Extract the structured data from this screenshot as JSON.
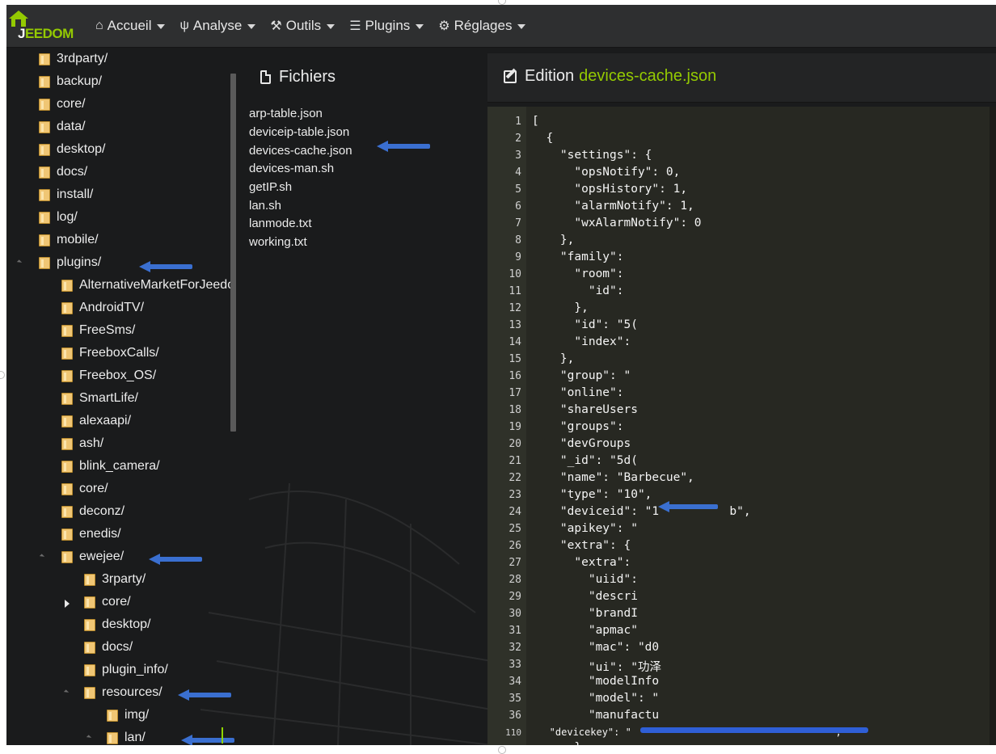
{
  "navbar": {
    "logo_text": "EEDOM",
    "logo_small_text": "Jeedom",
    "menus": [
      {
        "label": "Accueil",
        "icon": "home-icon"
      },
      {
        "label": "Analyse",
        "icon": "stethoscope-icon"
      },
      {
        "label": "Outils",
        "icon": "wrench-icon"
      },
      {
        "label": "Plugins",
        "icon": "tasks-icon"
      },
      {
        "label": "Réglages",
        "icon": "gear-icon"
      }
    ]
  },
  "tree": {
    "items": [
      {
        "label": "3rdparty/"
      },
      {
        "label": "backup/"
      },
      {
        "label": "core/"
      },
      {
        "label": "data/"
      },
      {
        "label": "desktop/"
      },
      {
        "label": "docs/"
      },
      {
        "label": "install/"
      },
      {
        "label": "log/"
      },
      {
        "label": "mobile/"
      },
      {
        "label": "plugins/"
      },
      {
        "label": "AlternativeMarketForJeedom/"
      },
      {
        "label": "AndroidTV/"
      },
      {
        "label": "FreeSms/"
      },
      {
        "label": "FreeboxCalls/"
      },
      {
        "label": "Freebox_OS/"
      },
      {
        "label": "SmartLife/"
      },
      {
        "label": "alexaapi/"
      },
      {
        "label": "ash/"
      },
      {
        "label": "blink_camera/"
      },
      {
        "label": "core/"
      },
      {
        "label": "deconz/"
      },
      {
        "label": "enedis/"
      },
      {
        "label": "ewejee/"
      },
      {
        "label": "3rparty/"
      },
      {
        "label": "core/"
      },
      {
        "label": "desktop/"
      },
      {
        "label": "docs/"
      },
      {
        "label": "plugin_info/"
      },
      {
        "label": "resources/"
      },
      {
        "label": "img/"
      },
      {
        "label": "lan/"
      }
    ]
  },
  "files": {
    "title": "Fichiers",
    "items": [
      "arp-table.json",
      "deviceip-table.json",
      "devices-cache.json",
      "devices-man.sh",
      "getIP.sh",
      "lan.sh",
      "lanmode.txt",
      "working.txt"
    ]
  },
  "editor": {
    "title_prefix": "Edition",
    "filename": "devices-cache.json",
    "lines": [
      {
        "n": "1",
        "t": "["
      },
      {
        "n": "2",
        "t": "  {"
      },
      {
        "n": "3",
        "t": "    \"settings\": {"
      },
      {
        "n": "4",
        "t": "      \"opsNotify\": 0,"
      },
      {
        "n": "5",
        "t": "      \"opsHistory\": 1,"
      },
      {
        "n": "6",
        "t": "      \"alarmNotify\": 1,"
      },
      {
        "n": "7",
        "t": "      \"wxAlarmNotify\": 0"
      },
      {
        "n": "8",
        "t": "    },"
      },
      {
        "n": "9",
        "t": "    \"family\":"
      },
      {
        "n": "10",
        "t": "      \"room\":"
      },
      {
        "n": "11",
        "t": "        \"id\":"
      },
      {
        "n": "12",
        "t": "      },"
      },
      {
        "n": "13",
        "t": "      \"id\": \"5("
      },
      {
        "n": "14",
        "t": "      \"index\":"
      },
      {
        "n": "15",
        "t": "    },"
      },
      {
        "n": "16",
        "t": "    \"group\": \""
      },
      {
        "n": "17",
        "t": "    \"online\":"
      },
      {
        "n": "18",
        "t": "    \"shareUsers"
      },
      {
        "n": "19",
        "t": "    \"groups\":"
      },
      {
        "n": "20",
        "t": "    \"devGroups"
      },
      {
        "n": "21",
        "t": "    \"_id\": \"5d("
      },
      {
        "n": "22",
        "t": "    \"name\": \"Barbecue\","
      },
      {
        "n": "23",
        "t": "    \"type\": \"10\","
      },
      {
        "n": "24",
        "t": "    \"deviceid\": \"1          b\","
      },
      {
        "n": "25",
        "t": "    \"apikey\": \""
      },
      {
        "n": "26",
        "t": "    \"extra\": {"
      },
      {
        "n": "27",
        "t": "      \"extra\":"
      },
      {
        "n": "28",
        "t": "        \"uiid\":"
      },
      {
        "n": "29",
        "t": "        \"descri"
      },
      {
        "n": "30",
        "t": "        \"brandI"
      },
      {
        "n": "31",
        "t": "        \"apmac\""
      },
      {
        "n": "32",
        "t": "        \"mac\": \"d0"
      },
      {
        "n": "33",
        "t": "        \"ui\": \"功泽"
      },
      {
        "n": "34",
        "t": "        \"modelInfo"
      },
      {
        "n": "35",
        "t": "        \"model\": \""
      },
      {
        "n": "36",
        "t": "        \"manufactu"
      },
      {
        "n": "110",
        "t": "   \"devicekey\": \"                                  \","
      },
      {
        "n": "",
        "t": "      },"
      }
    ]
  }
}
